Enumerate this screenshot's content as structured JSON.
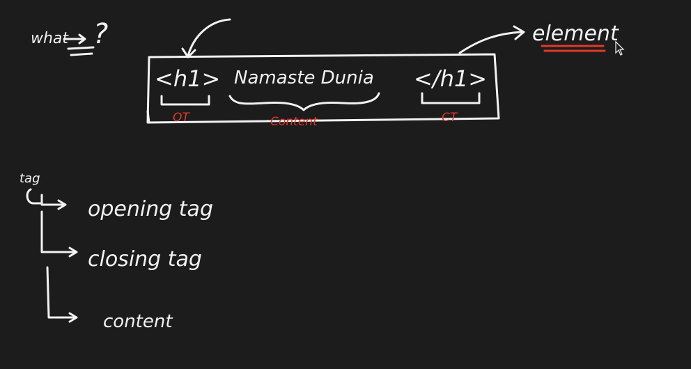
{
  "header": {
    "what_label": "what",
    "question_mark": "?"
  },
  "element_box": {
    "opening_tag": "<h1>",
    "content_text": "Namaste  Dunia",
    "closing_tag": "</h1>",
    "ot_label": "OT",
    "content_label": "Content",
    "ct_label": "CT"
  },
  "element_label": "element",
  "tag_tree": {
    "root": "tag",
    "children": [
      "opening tag",
      "closing tag",
      "content"
    ]
  },
  "colors": {
    "background": "#1c1c1c",
    "ink": "#f2f2f2",
    "accent": "#e0392b"
  },
  "icons": [
    "mouse-cursor-icon"
  ]
}
